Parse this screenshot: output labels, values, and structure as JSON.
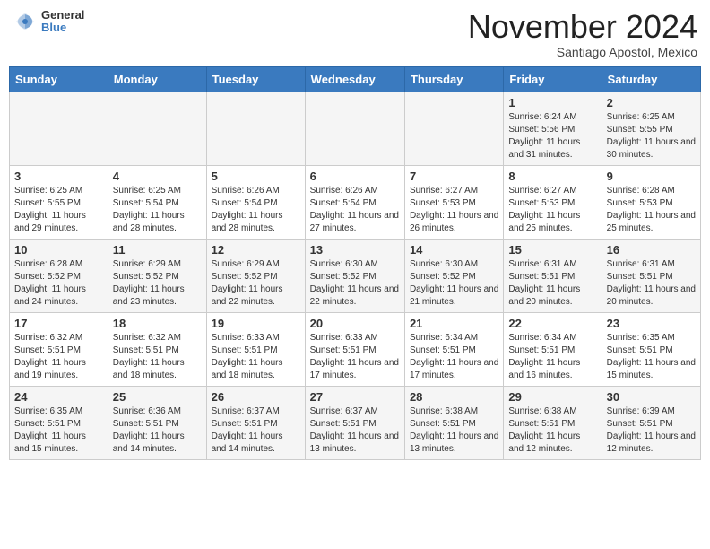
{
  "header": {
    "logo_general": "General",
    "logo_blue": "Blue",
    "month": "November 2024",
    "location": "Santiago Apostol, Mexico"
  },
  "weekdays": [
    "Sunday",
    "Monday",
    "Tuesday",
    "Wednesday",
    "Thursday",
    "Friday",
    "Saturday"
  ],
  "weeks": [
    [
      {
        "day": "",
        "info": ""
      },
      {
        "day": "",
        "info": ""
      },
      {
        "day": "",
        "info": ""
      },
      {
        "day": "",
        "info": ""
      },
      {
        "day": "",
        "info": ""
      },
      {
        "day": "1",
        "info": "Sunrise: 6:24 AM\nSunset: 5:56 PM\nDaylight: 11 hours\nand 31 minutes."
      },
      {
        "day": "2",
        "info": "Sunrise: 6:25 AM\nSunset: 5:55 PM\nDaylight: 11 hours\nand 30 minutes."
      }
    ],
    [
      {
        "day": "3",
        "info": "Sunrise: 6:25 AM\nSunset: 5:55 PM\nDaylight: 11 hours\nand 29 minutes."
      },
      {
        "day": "4",
        "info": "Sunrise: 6:25 AM\nSunset: 5:54 PM\nDaylight: 11 hours\nand 28 minutes."
      },
      {
        "day": "5",
        "info": "Sunrise: 6:26 AM\nSunset: 5:54 PM\nDaylight: 11 hours\nand 28 minutes."
      },
      {
        "day": "6",
        "info": "Sunrise: 6:26 AM\nSunset: 5:54 PM\nDaylight: 11 hours\nand 27 minutes."
      },
      {
        "day": "7",
        "info": "Sunrise: 6:27 AM\nSunset: 5:53 PM\nDaylight: 11 hours\nand 26 minutes."
      },
      {
        "day": "8",
        "info": "Sunrise: 6:27 AM\nSunset: 5:53 PM\nDaylight: 11 hours\nand 25 minutes."
      },
      {
        "day": "9",
        "info": "Sunrise: 6:28 AM\nSunset: 5:53 PM\nDaylight: 11 hours\nand 25 minutes."
      }
    ],
    [
      {
        "day": "10",
        "info": "Sunrise: 6:28 AM\nSunset: 5:52 PM\nDaylight: 11 hours\nand 24 minutes."
      },
      {
        "day": "11",
        "info": "Sunrise: 6:29 AM\nSunset: 5:52 PM\nDaylight: 11 hours\nand 23 minutes."
      },
      {
        "day": "12",
        "info": "Sunrise: 6:29 AM\nSunset: 5:52 PM\nDaylight: 11 hours\nand 22 minutes."
      },
      {
        "day": "13",
        "info": "Sunrise: 6:30 AM\nSunset: 5:52 PM\nDaylight: 11 hours\nand 22 minutes."
      },
      {
        "day": "14",
        "info": "Sunrise: 6:30 AM\nSunset: 5:52 PM\nDaylight: 11 hours\nand 21 minutes."
      },
      {
        "day": "15",
        "info": "Sunrise: 6:31 AM\nSunset: 5:51 PM\nDaylight: 11 hours\nand 20 minutes."
      },
      {
        "day": "16",
        "info": "Sunrise: 6:31 AM\nSunset: 5:51 PM\nDaylight: 11 hours\nand 20 minutes."
      }
    ],
    [
      {
        "day": "17",
        "info": "Sunrise: 6:32 AM\nSunset: 5:51 PM\nDaylight: 11 hours\nand 19 minutes."
      },
      {
        "day": "18",
        "info": "Sunrise: 6:32 AM\nSunset: 5:51 PM\nDaylight: 11 hours\nand 18 minutes."
      },
      {
        "day": "19",
        "info": "Sunrise: 6:33 AM\nSunset: 5:51 PM\nDaylight: 11 hours\nand 18 minutes."
      },
      {
        "day": "20",
        "info": "Sunrise: 6:33 AM\nSunset: 5:51 PM\nDaylight: 11 hours\nand 17 minutes."
      },
      {
        "day": "21",
        "info": "Sunrise: 6:34 AM\nSunset: 5:51 PM\nDaylight: 11 hours\nand 17 minutes."
      },
      {
        "day": "22",
        "info": "Sunrise: 6:34 AM\nSunset: 5:51 PM\nDaylight: 11 hours\nand 16 minutes."
      },
      {
        "day": "23",
        "info": "Sunrise: 6:35 AM\nSunset: 5:51 PM\nDaylight: 11 hours\nand 15 minutes."
      }
    ],
    [
      {
        "day": "24",
        "info": "Sunrise: 6:35 AM\nSunset: 5:51 PM\nDaylight: 11 hours\nand 15 minutes."
      },
      {
        "day": "25",
        "info": "Sunrise: 6:36 AM\nSunset: 5:51 PM\nDaylight: 11 hours\nand 14 minutes."
      },
      {
        "day": "26",
        "info": "Sunrise: 6:37 AM\nSunset: 5:51 PM\nDaylight: 11 hours\nand 14 minutes."
      },
      {
        "day": "27",
        "info": "Sunrise: 6:37 AM\nSunset: 5:51 PM\nDaylight: 11 hours\nand 13 minutes."
      },
      {
        "day": "28",
        "info": "Sunrise: 6:38 AM\nSunset: 5:51 PM\nDaylight: 11 hours\nand 13 minutes."
      },
      {
        "day": "29",
        "info": "Sunrise: 6:38 AM\nSunset: 5:51 PM\nDaylight: 11 hours\nand 12 minutes."
      },
      {
        "day": "30",
        "info": "Sunrise: 6:39 AM\nSunset: 5:51 PM\nDaylight: 11 hours\nand 12 minutes."
      }
    ]
  ]
}
